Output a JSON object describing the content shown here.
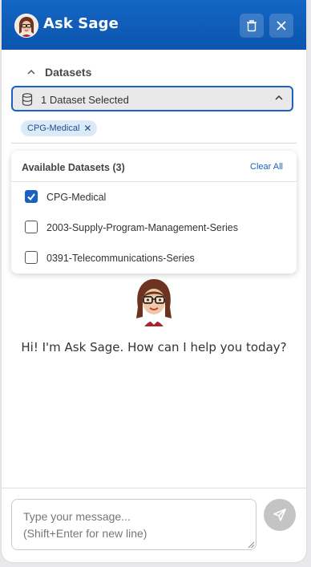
{
  "header": {
    "title": "Ask Sage",
    "bg_color": "#0d5cb6"
  },
  "datasets": {
    "toggle_label": "Datasets",
    "select_text": "1 Dataset Selected",
    "chip_label": "CPG-Medical",
    "chip_remove": "✕"
  },
  "dropdown": {
    "title": "Available Datasets (3)",
    "clear_label": "Clear All",
    "items": [
      {
        "label": "CPG-Medical",
        "checked": true
      },
      {
        "label": "2003-Supply-Program-Management-Series",
        "checked": false
      },
      {
        "label": "0391-Telecommunications-Series",
        "checked": false
      }
    ]
  },
  "main": {
    "greeting": "Hi! I'm Ask Sage. How can I help you today?"
  },
  "composer": {
    "placeholder": "Type your message...\n(Shift+Enter for new line)"
  },
  "icons": {
    "trash": "trash-icon",
    "close": "close-icon",
    "database": "database-icon",
    "chevron_up": "chevron-up-icon",
    "check": "check-icon",
    "send": "send-icon"
  },
  "colors": {
    "accent": "#1a62c2",
    "chip_bg": "#dceaf8",
    "send_disabled": "#c4c4c4"
  }
}
